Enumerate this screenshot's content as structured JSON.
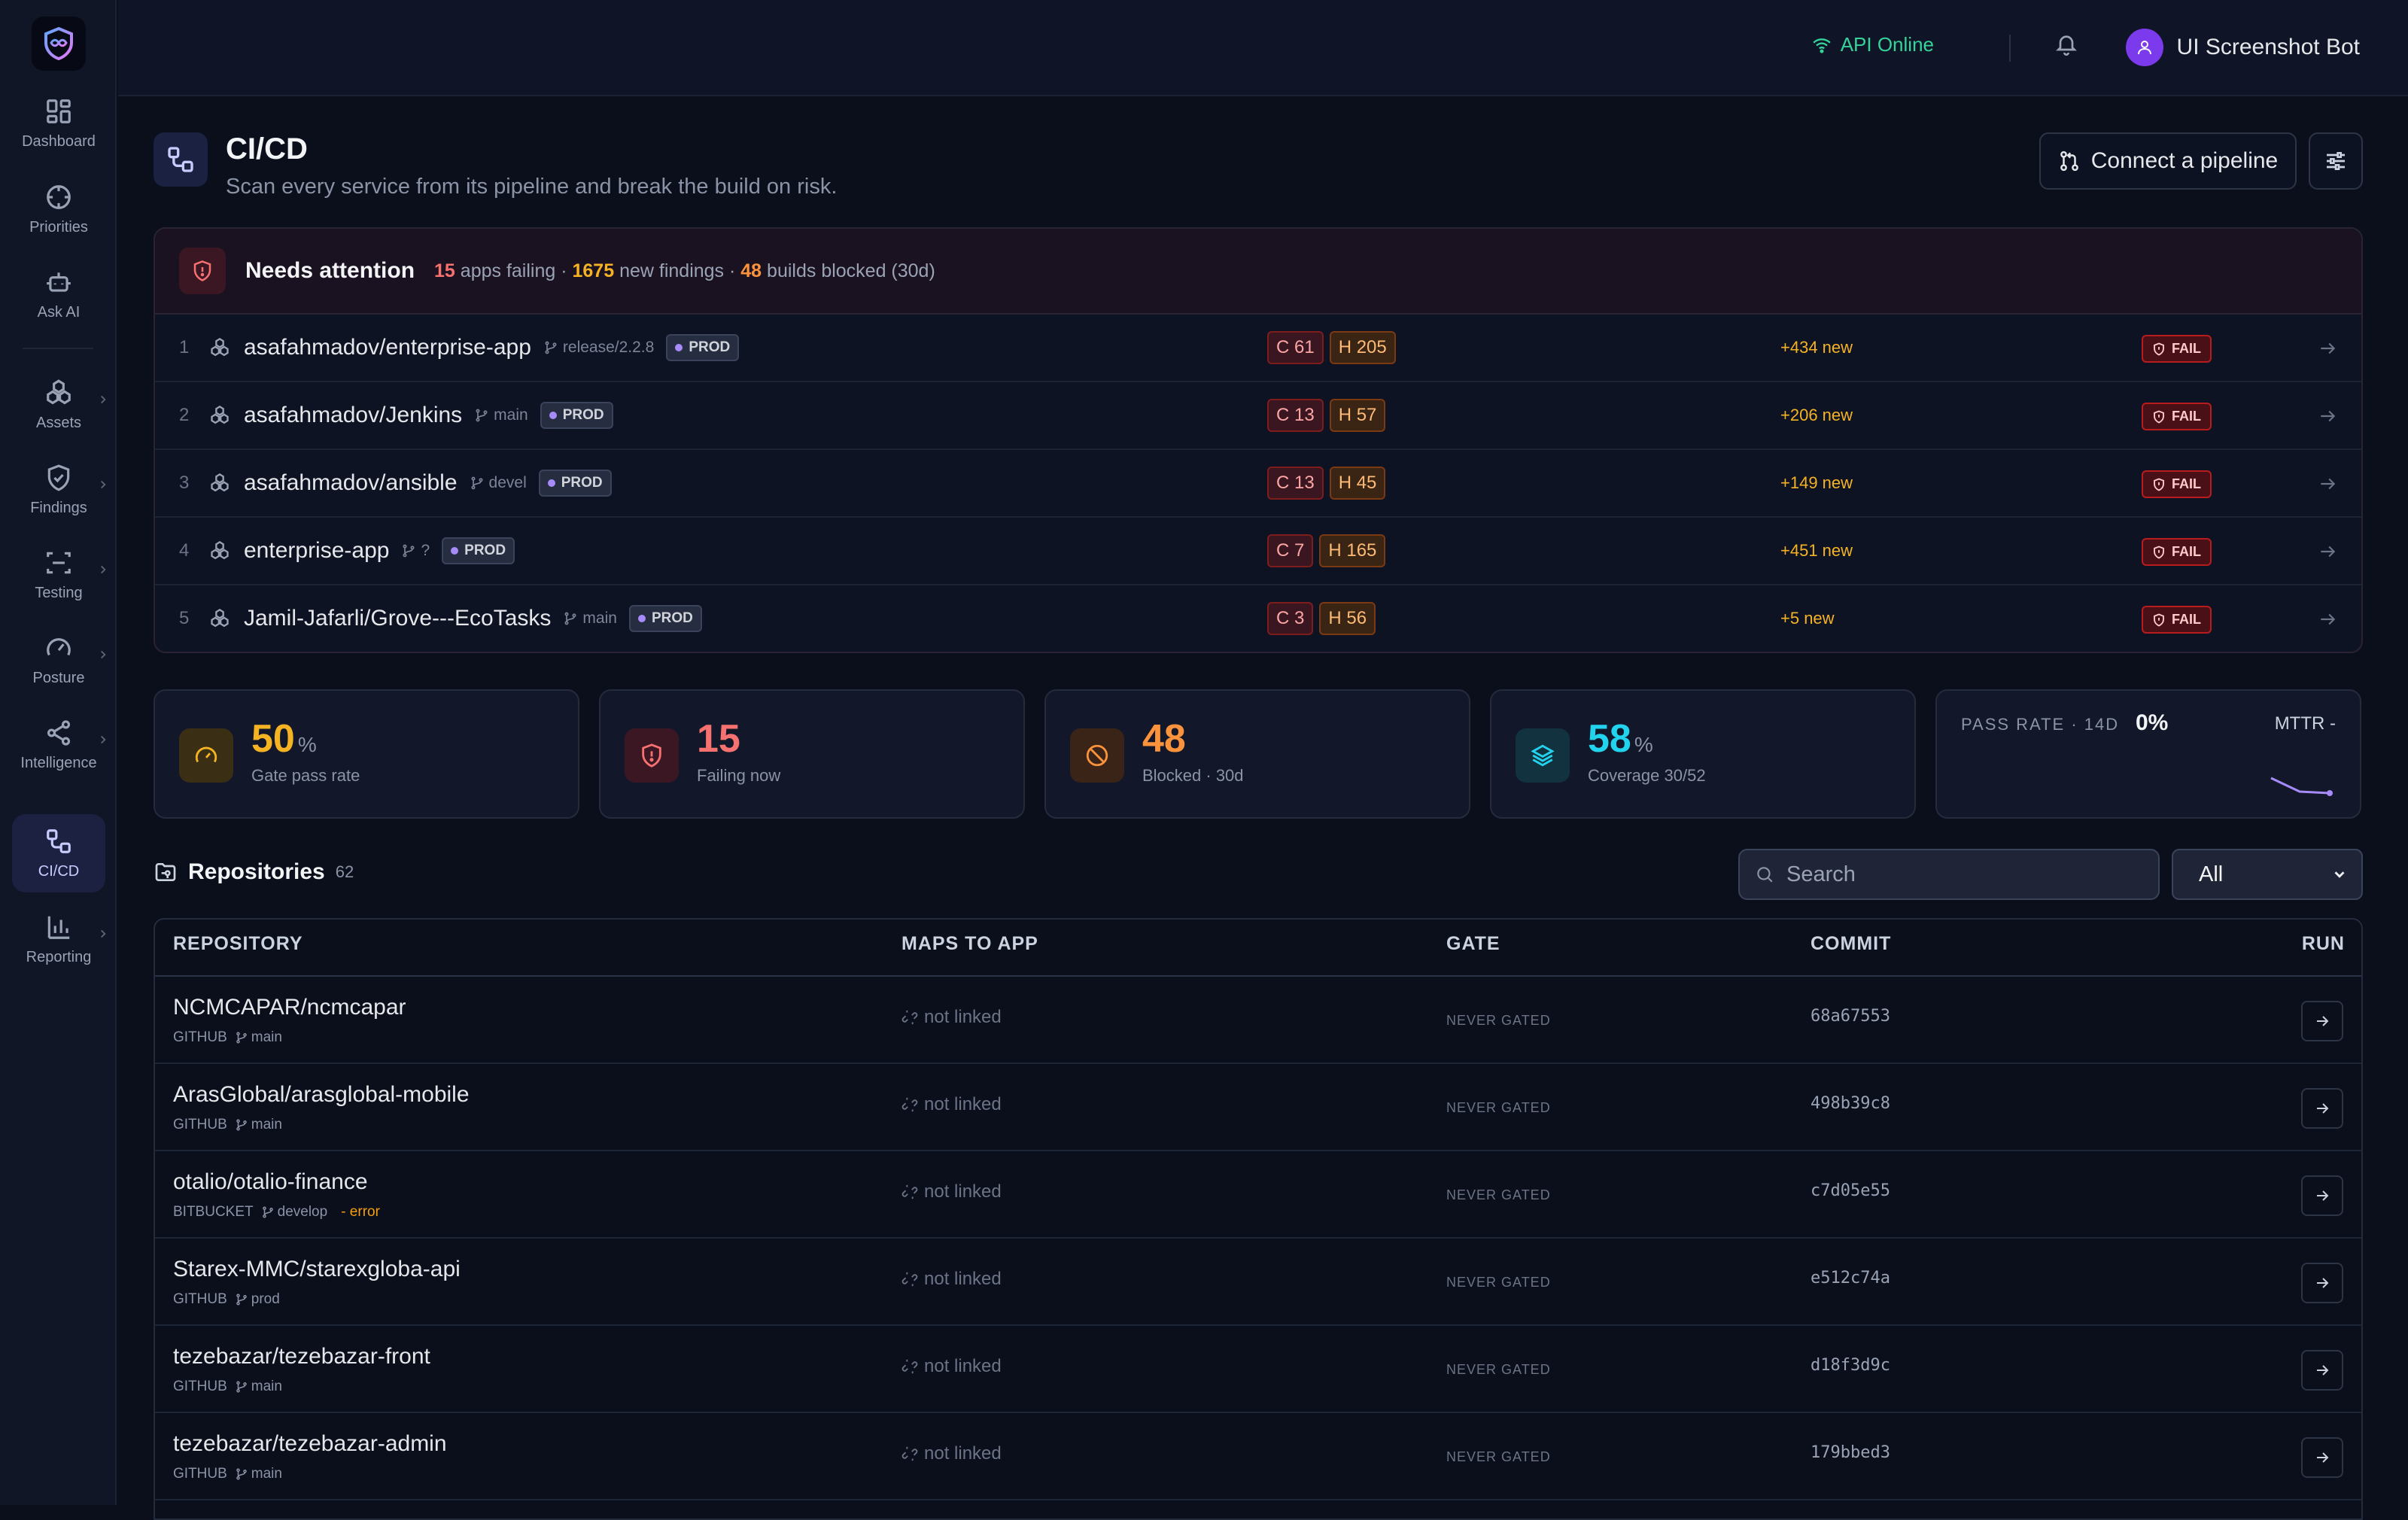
{
  "topbar": {
    "api_status": "API Online",
    "user_name": "UI Screenshot Bot"
  },
  "sidebar": {
    "items": [
      {
        "label": "Dashboard",
        "icon": "dashboard-icon"
      },
      {
        "label": "Priorities",
        "icon": "crosshair-icon"
      },
      {
        "label": "Ask AI",
        "icon": "robot-icon"
      },
      {
        "label": "Assets",
        "icon": "boxes-icon"
      },
      {
        "label": "Findings",
        "icon": "shield-check-icon"
      },
      {
        "label": "Testing",
        "icon": "scan-icon"
      },
      {
        "label": "Posture",
        "icon": "gauge-icon"
      },
      {
        "label": "Intelligence",
        "icon": "share-icon"
      },
      {
        "label": "CI/CD",
        "icon": "workflow-icon"
      },
      {
        "label": "Reporting",
        "icon": "bar-chart-icon"
      }
    ]
  },
  "header": {
    "title": "CI/CD",
    "subtitle": "Scan every service from its pipeline and break the build on risk.",
    "connect_label": "Connect a pipeline"
  },
  "attention": {
    "title": "Needs attention",
    "apps_failing": "15",
    "apps_failing_label": "apps failing ·",
    "new_findings": "1675",
    "new_findings_label": "new findings ·",
    "builds_blocked": "48",
    "builds_blocked_label": "builds blocked (30d)",
    "rows": [
      {
        "num": "1",
        "name": "asafahmadov/enterprise-app",
        "branch": "release/2.2.8",
        "env": "PROD",
        "c": "C 61",
        "h": "H 205",
        "new": "+434 new",
        "status": "FAIL"
      },
      {
        "num": "2",
        "name": "asafahmadov/Jenkins",
        "branch": "main",
        "env": "PROD",
        "c": "C 13",
        "h": "H 57",
        "new": "+206 new",
        "status": "FAIL"
      },
      {
        "num": "3",
        "name": "asafahmadov/ansible",
        "branch": "devel",
        "env": "PROD",
        "c": "C 13",
        "h": "H 45",
        "new": "+149 new",
        "status": "FAIL"
      },
      {
        "num": "4",
        "name": "enterprise-app",
        "branch": "?",
        "env": "PROD",
        "c": "C 7",
        "h": "H 165",
        "new": "+451 new",
        "status": "FAIL"
      },
      {
        "num": "5",
        "name": "Jamil-Jafarli/Grove---EcoTasks",
        "branch": "main",
        "env": "PROD",
        "c": "C 3",
        "h": "H 56",
        "new": "+5 new",
        "status": "FAIL"
      }
    ]
  },
  "stats": {
    "gate_pass": {
      "value": "50",
      "unit": "%",
      "label": "Gate pass rate",
      "color": "#f5b324"
    },
    "failing": {
      "value": "15",
      "label": "Failing now",
      "color": "#f87171"
    },
    "blocked": {
      "value": "48",
      "label": "Blocked · 30d",
      "color": "#fb923c"
    },
    "coverage": {
      "value": "58",
      "unit": "%",
      "label": "Coverage 30/52",
      "color": "#22d3ee"
    },
    "pass_rate": {
      "label": "PASS RATE · 14D",
      "value": "0%",
      "mttr": "MTTR -"
    }
  },
  "repositories": {
    "title": "Repositories",
    "count": "62",
    "search_placeholder": "Search",
    "filter_value": "All",
    "columns": [
      "REPOSITORY",
      "MAPS TO APP",
      "GATE",
      "COMMIT",
      "RUN"
    ],
    "rows": [
      {
        "name": "NCMCAPAR/ncmcapar",
        "provider": "GITHUB",
        "branch": "main",
        "error": "",
        "app": "not linked",
        "gate": "NEVER GATED",
        "commit": "68a67553"
      },
      {
        "name": "ArasGlobal/arasglobal-mobile",
        "provider": "GITHUB",
        "branch": "main",
        "error": "",
        "app": "not linked",
        "gate": "NEVER GATED",
        "commit": "498b39c8"
      },
      {
        "name": "otalio/otalio-finance",
        "provider": "BITBUCKET",
        "branch": "develop",
        "error": "- error",
        "app": "not linked",
        "gate": "NEVER GATED",
        "commit": "c7d05e55"
      },
      {
        "name": "Starex-MMC/starexgloba-api",
        "provider": "GITHUB",
        "branch": "prod",
        "error": "",
        "app": "not linked",
        "gate": "NEVER GATED",
        "commit": "e512c74a"
      },
      {
        "name": "tezebazar/tezebazar-front",
        "provider": "GITHUB",
        "branch": "main",
        "error": "",
        "app": "not linked",
        "gate": "NEVER GATED",
        "commit": "d18f3d9c"
      },
      {
        "name": "tezebazar/tezebazar-admin",
        "provider": "GITHUB",
        "branch": "main",
        "error": "",
        "app": "not linked",
        "gate": "NEVER GATED",
        "commit": "179bbed3"
      }
    ]
  }
}
